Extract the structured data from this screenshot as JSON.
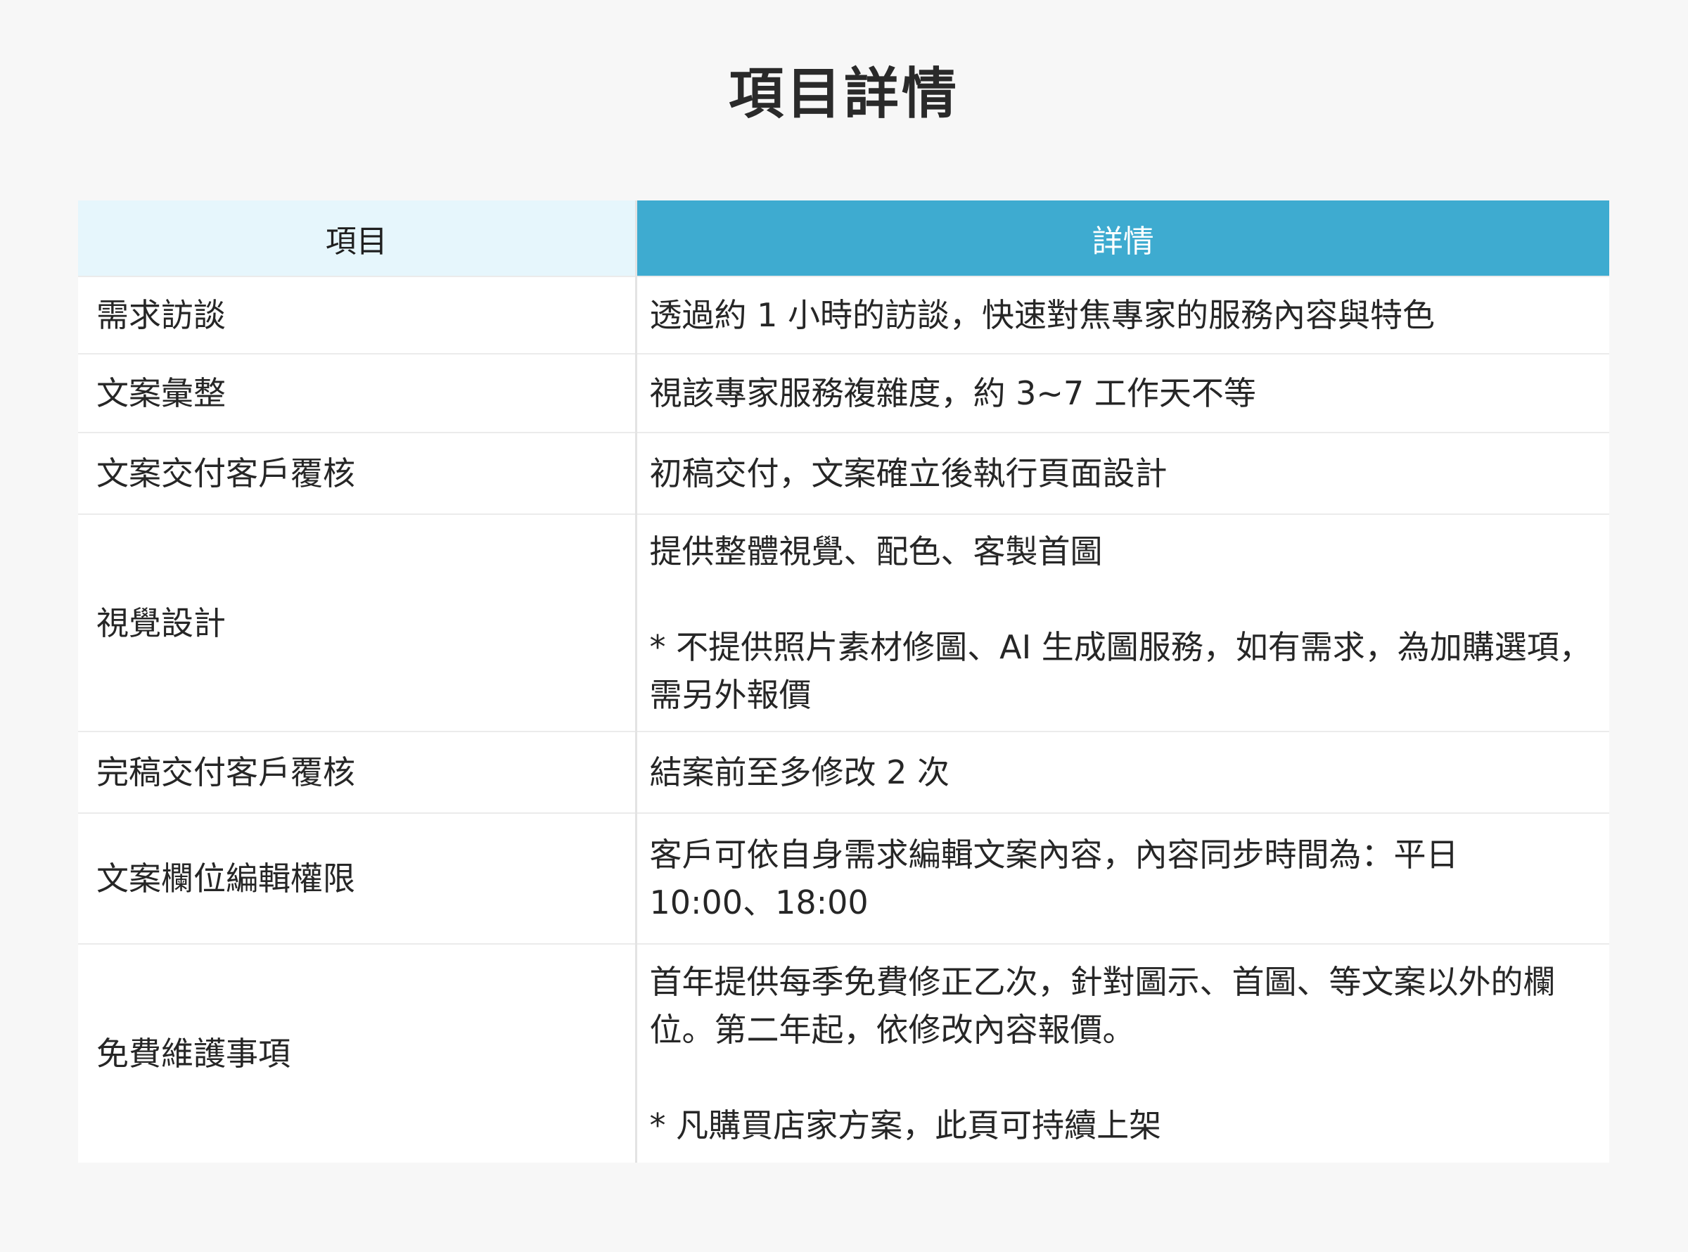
{
  "title": "項目詳情",
  "table": {
    "headers": {
      "item": "項目",
      "detail": "詳情"
    },
    "header_colors": {
      "item_bg": "#e6f6fc",
      "detail_bg": "#3eabd0",
      "detail_text": "#ffffff"
    },
    "rows": [
      {
        "item": "需求訪談",
        "detail": " 透過約 1 小時的訪談，快速對焦專家的服務內容與特色"
      },
      {
        "item": "文案彙整",
        "detail": "視該專家服務複雜度，約 3~7 工作天不等"
      },
      {
        "item": "文案交付客戶覆核",
        "detail": "初稿交付，文案確立後執行頁面設計"
      },
      {
        "item": "視覺設計",
        "detail": "提供整體視覺、配色、客製首圖\n\n* 不提供照片素材修圖、AI 生成圖服務，如有需求，為加購選項，需另外報價"
      },
      {
        "item": "完稿交付客戶覆核",
        "detail": "結案前至多修改 2 次"
      },
      {
        "item": "文案欄位編輯權限",
        "detail": "客戶可依自身需求編輯文案內容，內容同步時間為：平日 10:00、18:00"
      },
      {
        "item": "免費維護事項",
        "detail": "首年提供每季免費修正乙次，針對圖示、首圖、等文案以外的欄位。第二年起，依修改內容報價。\n\n* 凡購買店家方案，此頁可持續上架"
      }
    ]
  }
}
